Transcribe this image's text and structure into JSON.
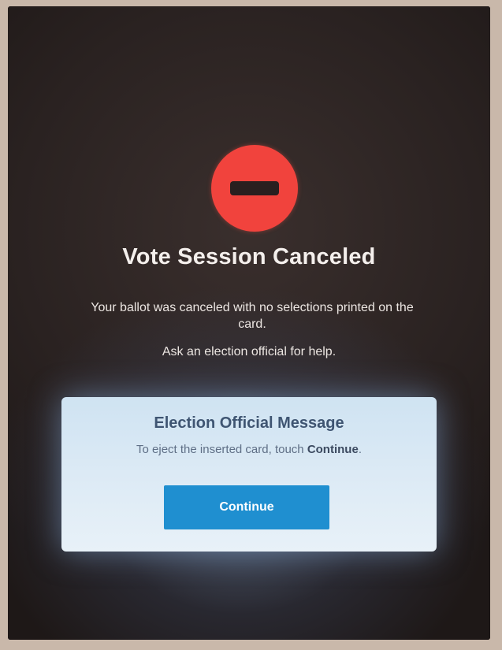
{
  "screen": {
    "icon": "stop-circle-icon",
    "title": "Vote Session Canceled",
    "description": "Your ballot was canceled with no selections printed on the card.",
    "help_text": "Ask an election official for help."
  },
  "official_panel": {
    "title": "Election Official Message",
    "text_prefix": "To eject the inserted card, touch ",
    "text_emphasis": "Continue",
    "text_suffix": ".",
    "button_label": "Continue"
  },
  "colors": {
    "stop_icon": "#f1433d",
    "button": "#1f8fd0",
    "panel_bg": "#dceaf5"
  }
}
